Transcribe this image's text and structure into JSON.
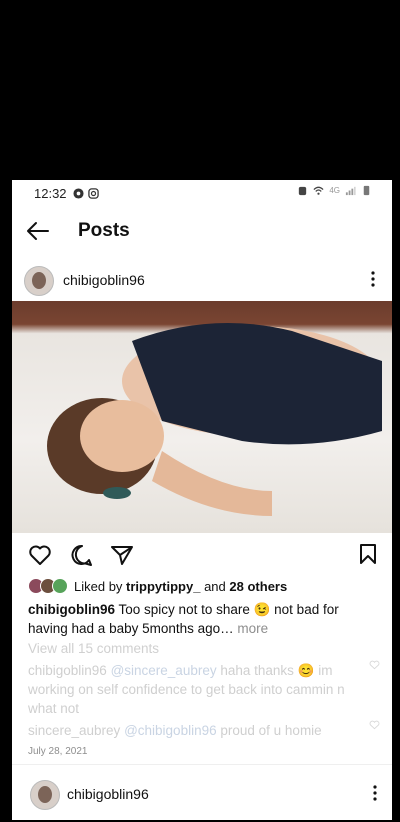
{
  "status_bar": {
    "time": "12:32",
    "network": "4G"
  },
  "header": {
    "title": "Posts"
  },
  "post": {
    "username": "chibigoblin96",
    "likes": {
      "liked_by_prefix": "Liked by",
      "liked_by_user": "trippytippy_",
      "and_text": "and",
      "others_text": "28 others"
    },
    "caption": {
      "user": "chibigoblin96",
      "text": "Too spicy not to share 😉 not bad for having had a baby 5months ago…",
      "more": "more"
    },
    "view_all": "View all 15 comments",
    "comments": [
      {
        "user": "chibigoblin96",
        "mention": "@sincere_aubrey",
        "text": "haha thanks 😊 im working on self confidence  to get back into cammin n what not"
      },
      {
        "user": "sincere_aubrey",
        "mention": "@chibigoblin96",
        "text": "proud of u homie"
      }
    ],
    "date": "July 28, 2021"
  },
  "next_post": {
    "username": "chibigoblin96"
  },
  "colors": {
    "secondary_text": "#8e8e8e",
    "faded_text": "#cfcfcf",
    "background": "#ffffff"
  }
}
